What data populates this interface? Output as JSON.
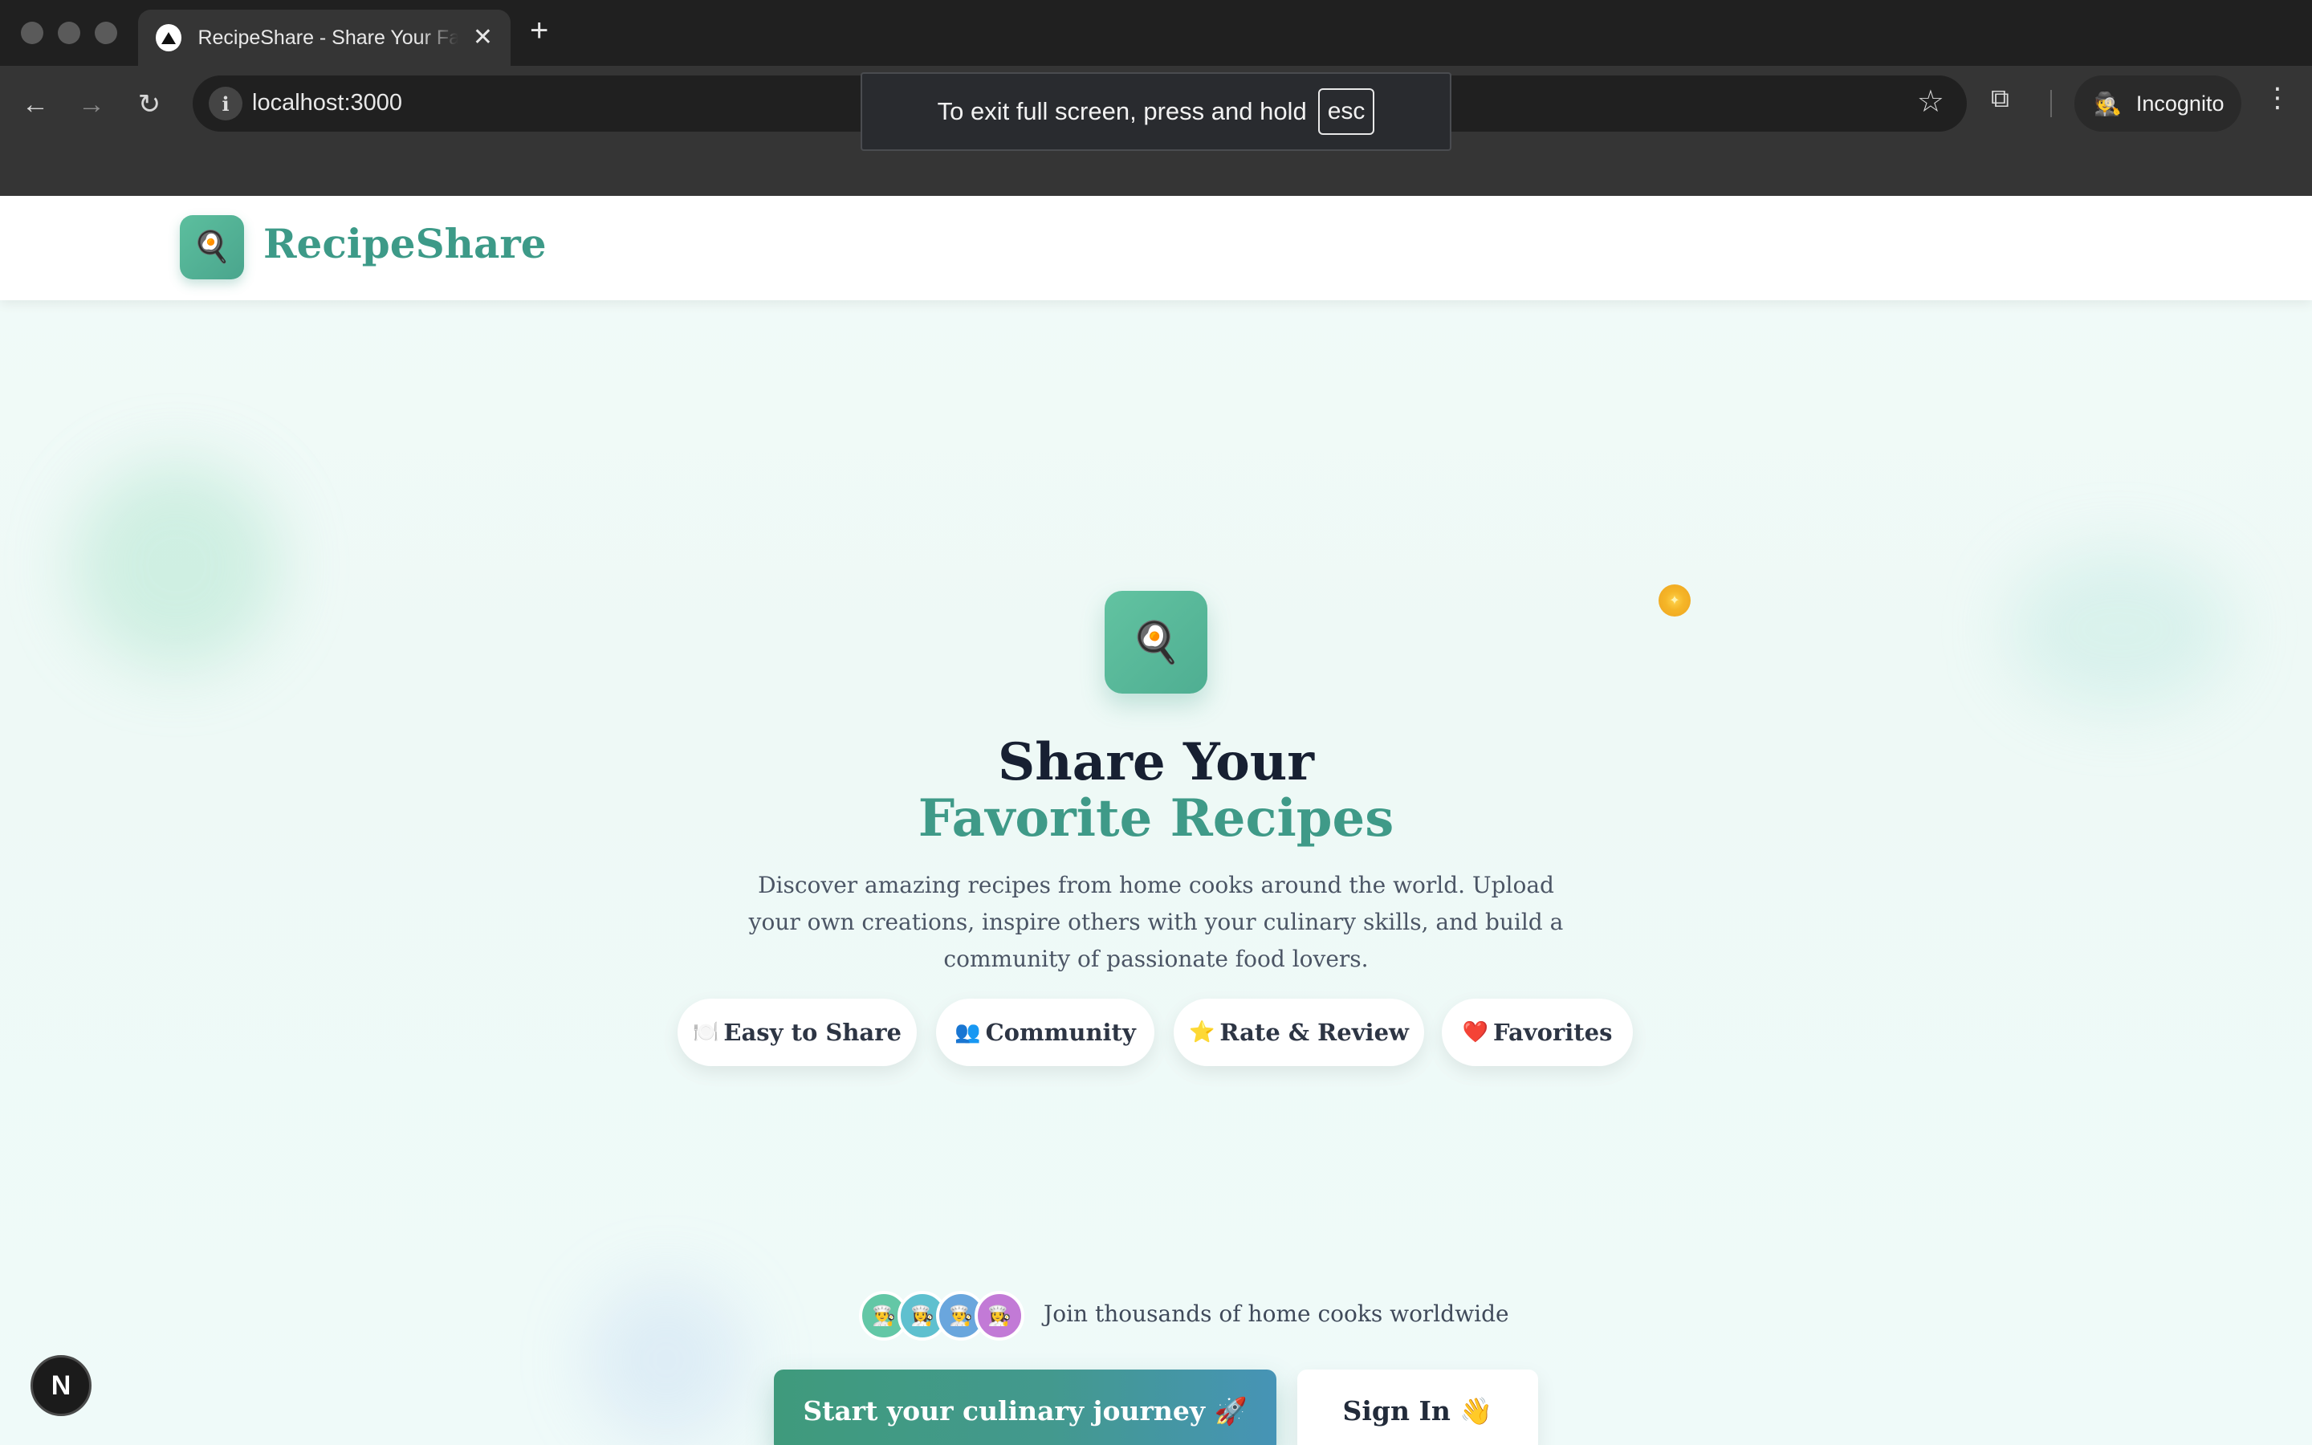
{
  "browser": {
    "tab_title": "RecipeShare - Share Your Favorite Recipes",
    "tab_close": "✕",
    "new_tab": "+",
    "url": "localhost:3000",
    "incognito_label": "Incognito",
    "fullscreen_message": "To exit full screen, press and hold",
    "fullscreen_key": "esc",
    "icons": {
      "back": "←",
      "forward": "→",
      "reload": "↻",
      "info": "i",
      "star": "☆",
      "lens": "⧉",
      "incognito": "🕵",
      "more": "⋮"
    }
  },
  "header": {
    "logo_emoji": "🍳",
    "brand_name": "RecipeShare"
  },
  "hero": {
    "icon_emoji": "🍳",
    "sparkle": "✦",
    "title_line1": "Share Your",
    "title_line2": "Favorite Recipes",
    "description": "Discover amazing recipes from home cooks around the world. Upload your own creations, inspire others with your culinary skills, and build a community of passionate food lovers.",
    "features": [
      {
        "emoji": "🍽️",
        "label": "Easy to Share"
      },
      {
        "emoji": "👥",
        "label": "Community"
      },
      {
        "emoji": "⭐",
        "label": "Rate & Review"
      },
      {
        "emoji": "❤️",
        "label": "Favorites"
      }
    ],
    "avatars": [
      "👨‍🍳",
      "👩‍🍳",
      "👨‍🍳",
      "👩‍🍳"
    ],
    "join_text": "Join thousands of home cooks worldwide",
    "primary_cta": "Start your culinary journey 🚀",
    "secondary_cta": "Sign In 👋"
  },
  "dev_badge": "N",
  "colors": {
    "brand": "#3f9a88",
    "heading": "#172032",
    "logo_bg": "#5cbf9e",
    "cta_gradient_start": "#3f9a7c",
    "cta_gradient_end": "#4694b6",
    "avatar_colors": [
      "#63c7a6",
      "#5fc0cf",
      "#6aa6dd",
      "#c27ad6"
    ]
  }
}
